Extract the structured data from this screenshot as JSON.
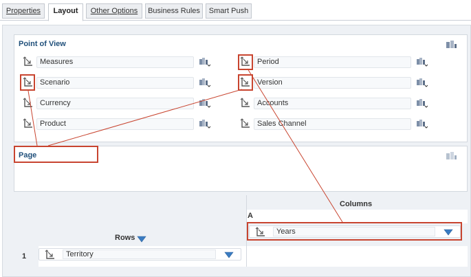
{
  "tabs": [
    {
      "label": "Properties",
      "active": false
    },
    {
      "label": "Layout",
      "active": true
    },
    {
      "label": "Other Options",
      "active": false
    },
    {
      "label": "Business Rules",
      "active": false
    },
    {
      "label": "Smart Push",
      "active": false
    }
  ],
  "pov": {
    "title": "Point of View",
    "left": [
      "Measures",
      "Scenario",
      "Currency",
      "Product"
    ],
    "right": [
      "Period",
      "Version",
      "Accounts",
      "Sales Channel"
    ]
  },
  "page": {
    "title": "Page"
  },
  "rows": {
    "label": "Rows",
    "index": "1",
    "dimension": "Territory"
  },
  "columns": {
    "label": "Columns",
    "segment": "A",
    "dimension": "Years"
  },
  "colors": {
    "highlight": "#c8442f",
    "title": "#1f4f7a",
    "accent": "#3a7cc2"
  },
  "icons": {
    "dimension": "dimension-axis-icon",
    "member": "member-selector-icon",
    "dropdown": "dropdown-arrow-icon"
  }
}
